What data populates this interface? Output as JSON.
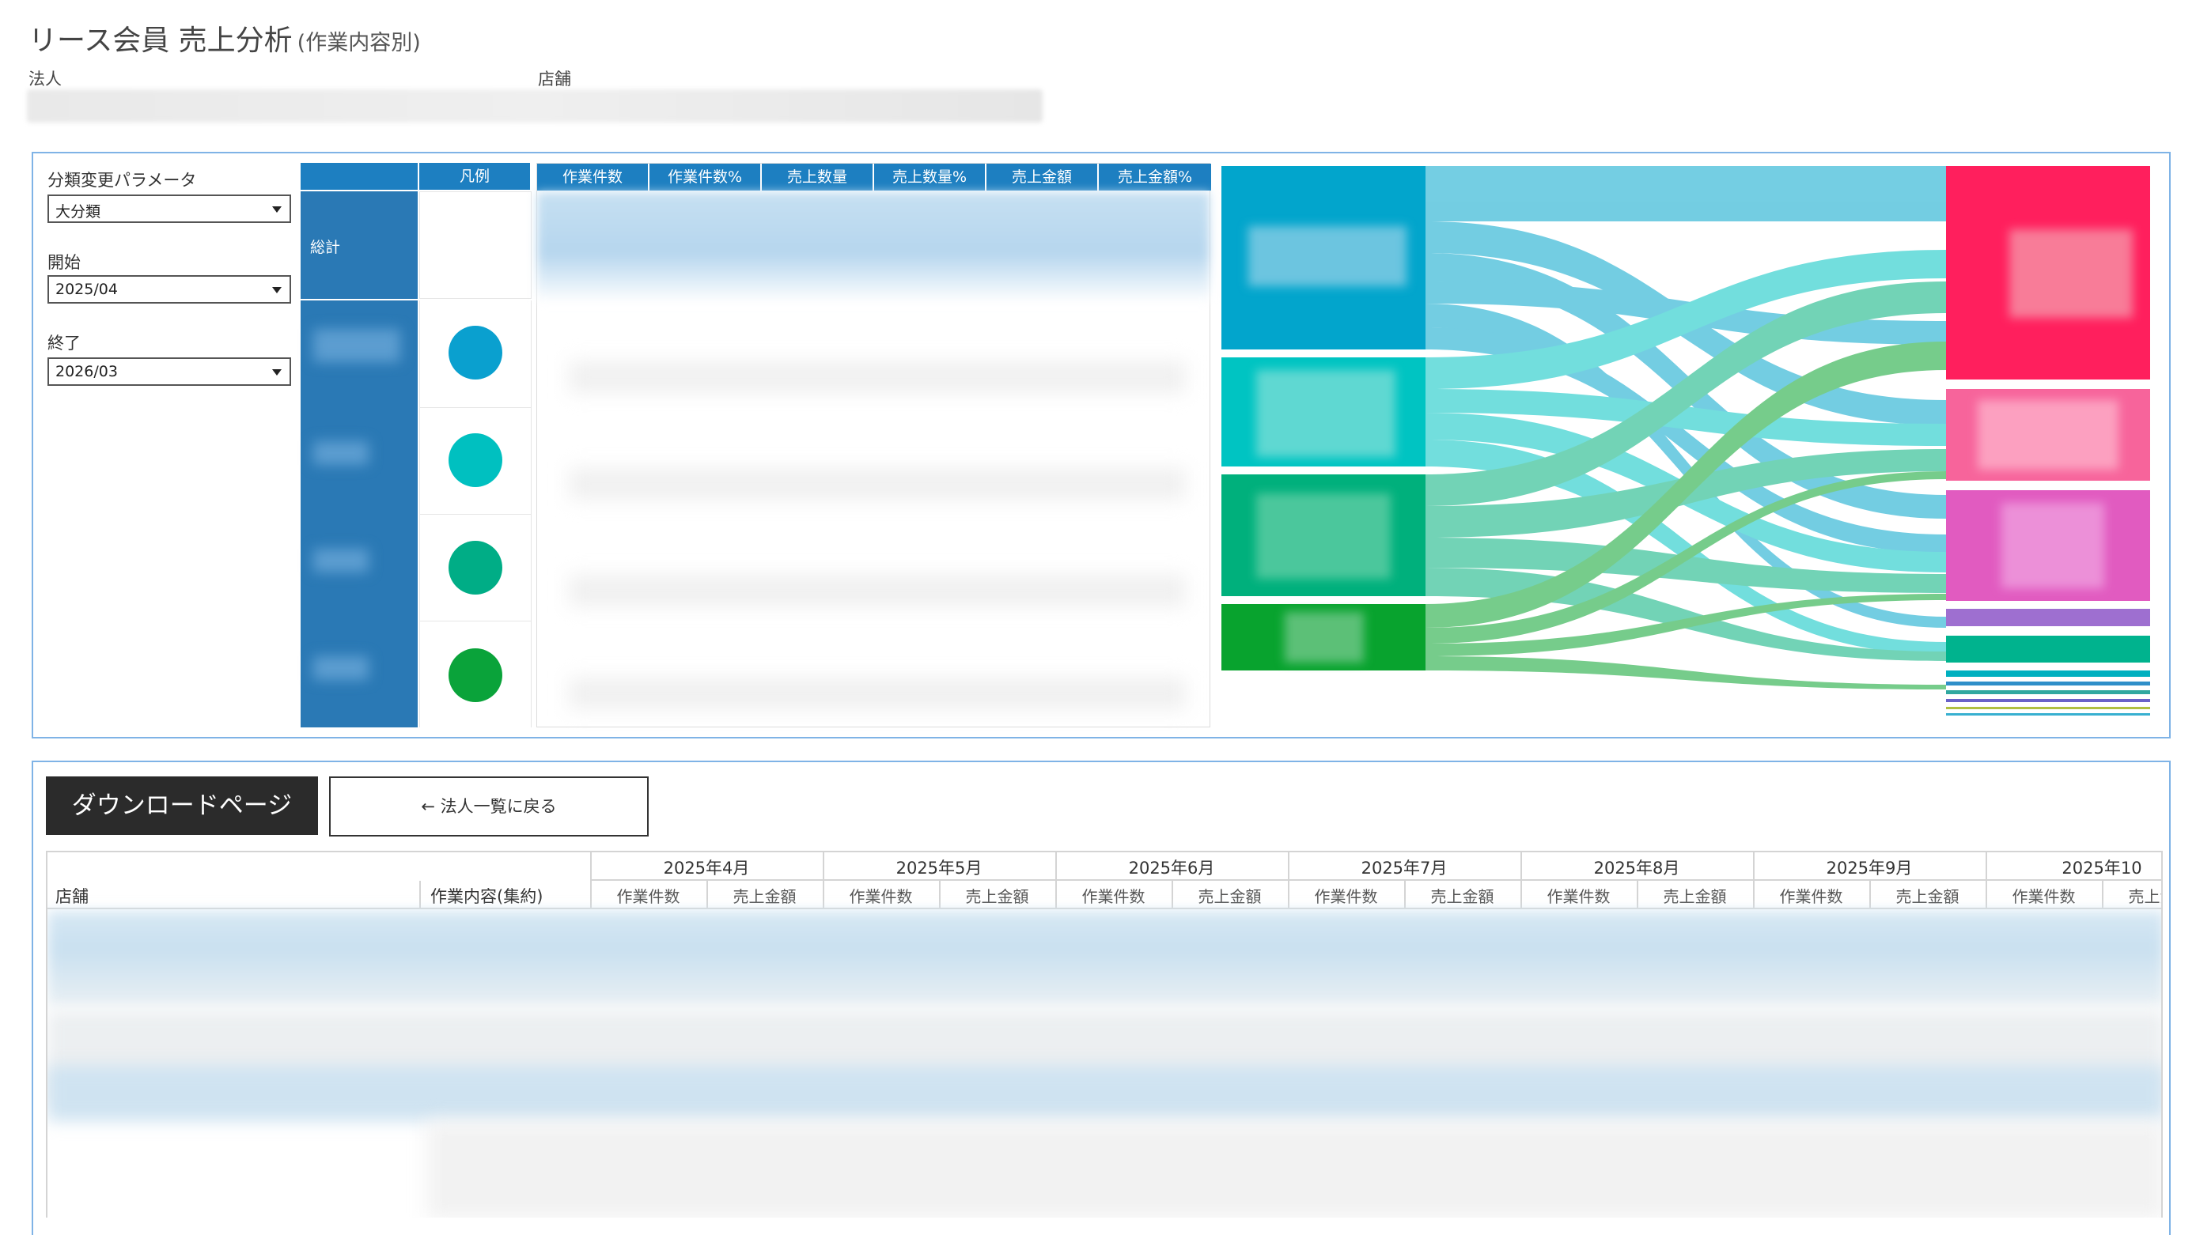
{
  "header": {
    "title": "リース会員 売上分析",
    "subtitle": "(作業内容別)",
    "filter_corp_label": "法人",
    "filter_store_label": "店舗"
  },
  "controls": {
    "param_label": "分類変更パラメータ",
    "param_value": "大分類",
    "start_label": "開始",
    "start_value": "2025/04",
    "end_label": "終了",
    "end_value": "2026/03"
  },
  "legend_table": {
    "legend_header": "凡例",
    "total_label": "総計",
    "circle_colors": [
      "#0aa0cf",
      "#00c0c0",
      "#00ad86",
      "#0aa33a"
    ]
  },
  "metrics_table": {
    "columns": [
      "作業件数",
      "作業件数%",
      "売上数量",
      "売上数量%",
      "売上金額",
      "売上金額%"
    ]
  },
  "sankey": {
    "left_colors": [
      "#02a5cc",
      "#00c4c2",
      "#00b07c",
      "#08a32e"
    ],
    "right_colors": [
      "#ff1f5d",
      "#f7649b",
      "#e15bc0",
      "#9e6fd0",
      "#00b38e"
    ]
  },
  "buttons": {
    "download_label": "ダウンロードページ",
    "back_label": "← 法人一覧に戻る"
  },
  "bottom_table": {
    "col_store": "店舗",
    "col_work": "作業内容(集約)",
    "months": [
      "2025年4月",
      "2025年5月",
      "2025年6月",
      "2025年7月",
      "2025年8月",
      "2025年9月",
      "2025年10"
    ],
    "sub_count": "作業件数",
    "sub_amount": "売上金額"
  }
}
